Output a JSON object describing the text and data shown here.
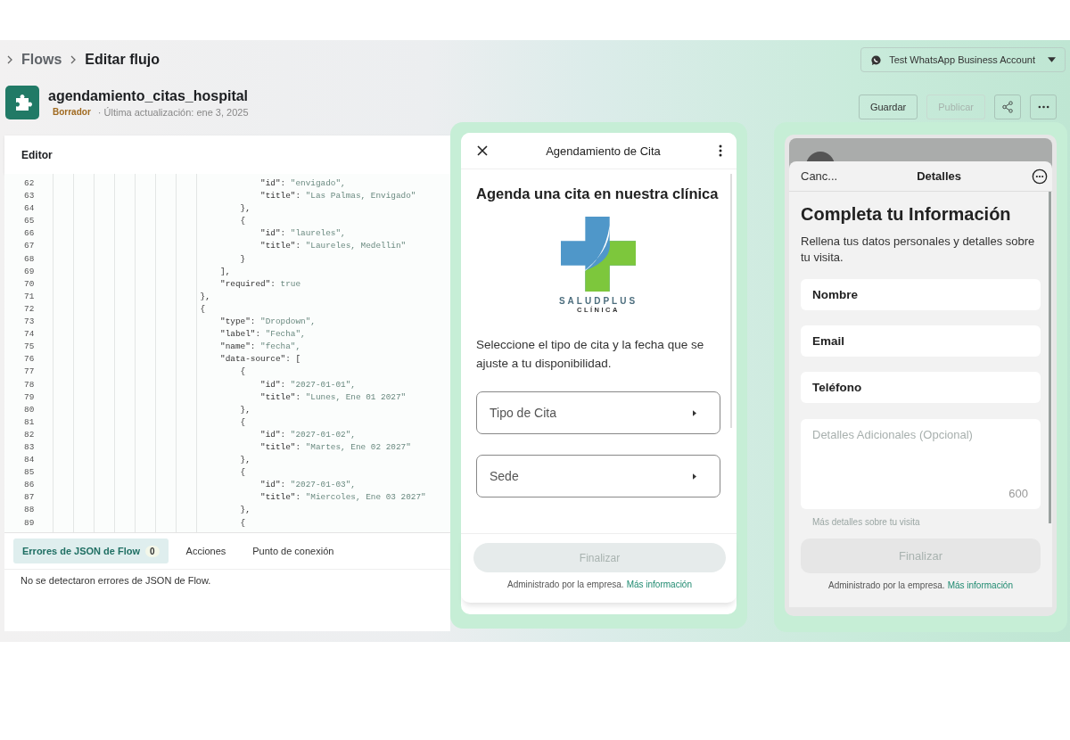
{
  "breadcrumb": [
    {
      "label": "Flows",
      "current": false
    },
    {
      "label": "Editar flujo",
      "current": true
    }
  ],
  "account_selector": {
    "label": "Test WhatsApp Business Account"
  },
  "flow": {
    "name": "agendamiento_citas_hospital",
    "status": "Borrador",
    "updated": "· Última actualización: ene 3, 2025"
  },
  "actions": [
    {
      "kind": "text",
      "label": "Guardar",
      "disabled": false
    },
    {
      "kind": "text",
      "label": "Publicar",
      "disabled": true
    },
    {
      "kind": "share"
    },
    {
      "kind": "more"
    }
  ],
  "editor": {
    "title": "Editor",
    "lines": [
      {
        "n": "62",
        "key": "                                        \"id\": ",
        "value": "\"envigado\","
      },
      {
        "n": "63",
        "key": "                                        \"title\": ",
        "value": "\"Las Palmas, Envigado\""
      },
      {
        "n": "64",
        "key": "                                    },"
      },
      {
        "n": "65",
        "key": "                                    {"
      },
      {
        "n": "66",
        "key": "                                        \"id\": ",
        "value": "\"laureles\","
      },
      {
        "n": "67",
        "key": "                                        \"title\": ",
        "value": "\"Laureles, Medellin\""
      },
      {
        "n": "68",
        "key": "                                    }"
      },
      {
        "n": "69",
        "key": "                                ],"
      },
      {
        "n": "70",
        "key": "                                \"required\": ",
        "value": "true"
      },
      {
        "n": "71",
        "key": "                            },"
      },
      {
        "n": "72",
        "key": "                            {"
      },
      {
        "n": "73",
        "key": "                                \"type\": ",
        "value": "\"Dropdown\","
      },
      {
        "n": "74",
        "key": "                                \"label\": ",
        "value": "\"Fecha\","
      },
      {
        "n": "75",
        "key": "                                \"name\": ",
        "value": "\"fecha\","
      },
      {
        "n": "76",
        "key": "                                \"data-source\": ["
      },
      {
        "n": "77",
        "key": "                                    {"
      },
      {
        "n": "78",
        "key": "                                        \"id\": ",
        "value": "\"2027-01-01\","
      },
      {
        "n": "79",
        "key": "                                        \"title\": ",
        "value": "\"Lunes, Ene 01 2027\""
      },
      {
        "n": "80",
        "key": "                                    },"
      },
      {
        "n": "81",
        "key": "                                    {"
      },
      {
        "n": "82",
        "key": "                                        \"id\": ",
        "value": "\"2027-01-02\","
      },
      {
        "n": "83",
        "key": "                                        \"title\": ",
        "value": "\"Martes, Ene 02 2027\""
      },
      {
        "n": "84",
        "key": "                                    },"
      },
      {
        "n": "85",
        "key": "                                    {"
      },
      {
        "n": "86",
        "key": "                                        \"id\": ",
        "value": "\"2027-01-03\","
      },
      {
        "n": "87",
        "key": "                                        \"title\": ",
        "value": "\"Miercoles, Ene 03 2027\""
      },
      {
        "n": "88",
        "key": "                                    },"
      },
      {
        "n": "89",
        "key": "                                    {"
      }
    ],
    "tabs": [
      {
        "label": "Errores de JSON de Flow",
        "count": "0",
        "selected": true
      },
      {
        "label": "Acciones",
        "selected": false
      },
      {
        "label": "Punto de conexión",
        "selected": false
      }
    ],
    "message": "No se detectaron errores de JSON de Flow."
  },
  "preview_1": {
    "title": "Agendamiento de Cita",
    "heading": "Agenda una cita en nuestra clínica",
    "logo": {
      "name": "SALUDPLUS",
      "sub": "CLÍNICA"
    },
    "text": "Seleccione el tipo de cita y la fecha que se ajuste a tu disponibilidad.",
    "dropdowns": [
      {
        "label": "Tipo de Cita"
      },
      {
        "label": "Sede"
      }
    ],
    "button": {
      "label": "Finalizar",
      "disabled": true
    },
    "footer": {
      "text": "Administrado por la empresa.",
      "link": "Más información"
    }
  },
  "preview_2": {
    "cancel": "Canc...",
    "title": "Detalles",
    "heading": "Completa tu Información",
    "text": "Rellena tus datos personales y detalles sobre tu visita.",
    "fields": [
      {
        "kind": "input",
        "label": "Nombre"
      },
      {
        "kind": "input",
        "label": "Email"
      },
      {
        "kind": "input",
        "label": "Teléfono"
      },
      {
        "kind": "textarea",
        "placeholder": "Detalles Adicionales (Opcional)",
        "counter": "600",
        "helper": "Más detalles sobre tu visita"
      }
    ],
    "button": {
      "label": "Finalizar",
      "disabled": true
    },
    "footer": {
      "text": "Administrado por la empresa.",
      "link": "Más información"
    }
  }
}
